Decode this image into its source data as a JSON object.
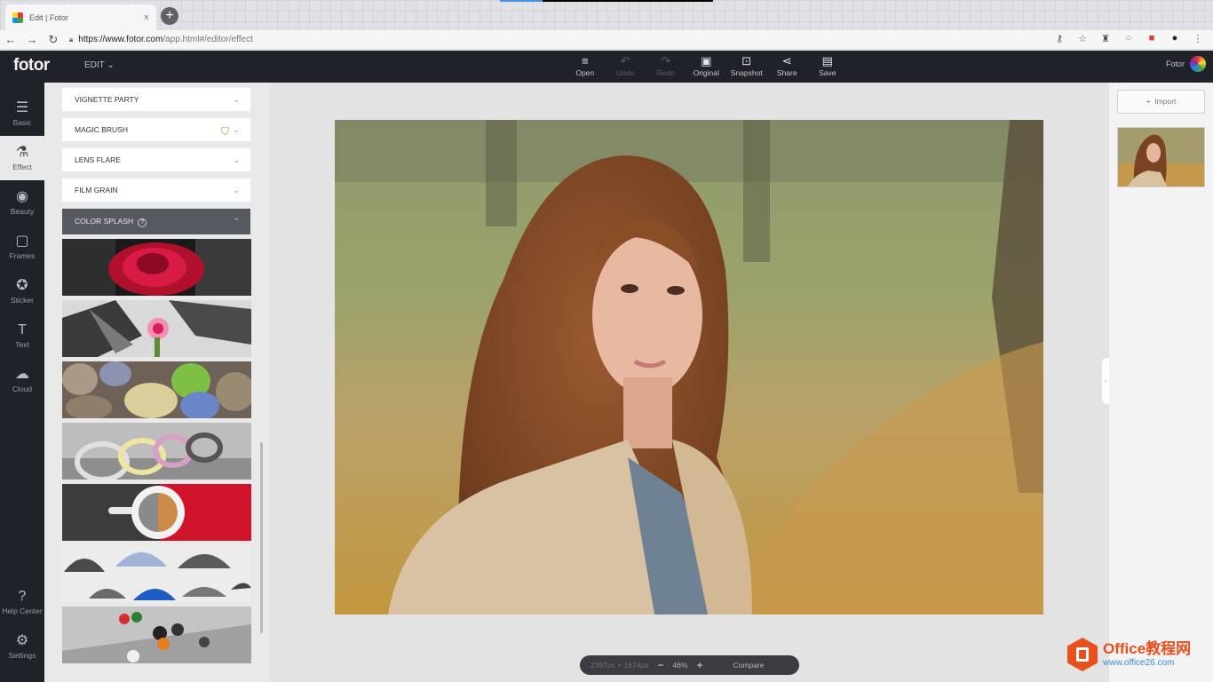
{
  "browser": {
    "tab_title": "Edit | Fotor",
    "tab_close": "×",
    "new_tab": "+",
    "url_domain": "https://www.fotor.com",
    "url_path": "/app.html#/editor/effect",
    "icons": [
      "key-icon",
      "star-icon",
      "extension-icon",
      "circle-icon",
      "color-icon",
      "avatar-icon",
      "menu-icon"
    ]
  },
  "app": {
    "logo": "fotor",
    "menu": "EDIT",
    "tools": [
      {
        "label": "Open",
        "icon": "≡",
        "enabled": true
      },
      {
        "label": "Undo",
        "icon": "↶",
        "enabled": false
      },
      {
        "label": "Redo",
        "icon": "↷",
        "enabled": false
      },
      {
        "label": "Original",
        "icon": "▣",
        "enabled": true
      },
      {
        "label": "Snapshot",
        "icon": "⊡",
        "enabled": true
      },
      {
        "label": "Share",
        "icon": "⋖",
        "enabled": true
      },
      {
        "label": "Save",
        "icon": "▤",
        "enabled": true
      }
    ],
    "user_label": "Fotor"
  },
  "leftnav": [
    {
      "label": "Basic",
      "icon": "☰"
    },
    {
      "label": "Effect",
      "icon": "⚗"
    },
    {
      "label": "Beauty",
      "icon": "◉"
    },
    {
      "label": "Frames",
      "icon": "▢"
    },
    {
      "label": "Sticker",
      "icon": "✪"
    },
    {
      "label": "Text",
      "icon": "T"
    },
    {
      "label": "Cloud",
      "icon": "☁"
    },
    {
      "label": "Help Center",
      "icon": "?"
    },
    {
      "label": "Settings",
      "icon": "⚙"
    }
  ],
  "effects": {
    "sections": [
      {
        "label": "VIGNETTE PARTY"
      },
      {
        "label": "MAGIC BRUSH"
      },
      {
        "label": "LENS FLARE"
      },
      {
        "label": "FILM GRAIN"
      }
    ],
    "open_section": "COLOR SPLASH",
    "help": "?",
    "chevron_down": "⌄",
    "chevron_up": "⌃"
  },
  "zoom": {
    "dimensions": "2397px × 1674px",
    "minus": "−",
    "level": "46%",
    "plus": "+",
    "compare": "Compare"
  },
  "right": {
    "import_label": "Import",
    "import_icon": "+"
  },
  "watermark": {
    "brand": "Office教程网",
    "url": "www.office26.com"
  }
}
